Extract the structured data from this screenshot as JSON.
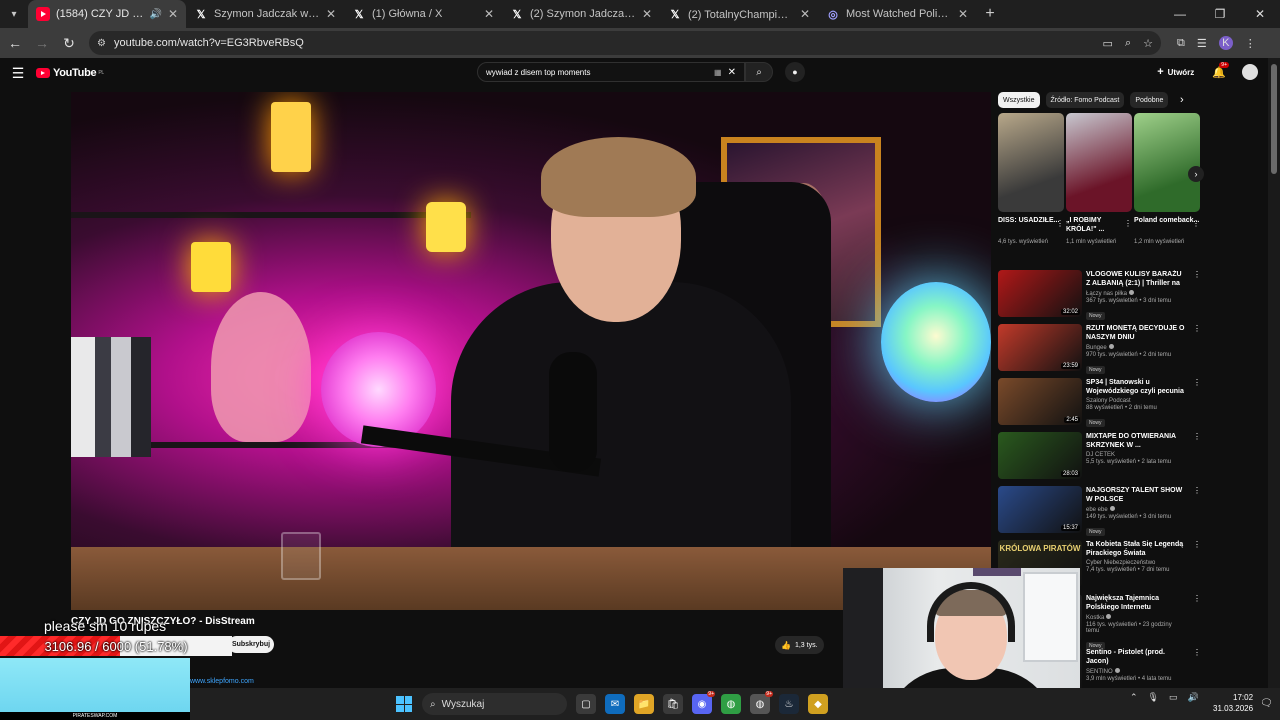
{
  "browser": {
    "tabs": [
      {
        "icon": "youtube-favicon",
        "title": "(1584) CZY JD GO ZNISZCZYŁO",
        "active": true,
        "audio": true
      },
      {
        "icon": "x-favicon",
        "title": "Szymon Jadczak w serwisie X: ..."
      },
      {
        "icon": "x-favicon",
        "title": "(1) Główna / X"
      },
      {
        "icon": "x-favicon",
        "title": "(2) Szymon Jadczak w serwisie X..."
      },
      {
        "icon": "x-favicon",
        "title": "(2) TotalnyChampion 🎅🧀 w serwisie X"
      },
      {
        "icon": "streams-favicon",
        "title": "Most Watched Polish Twitch Streams"
      }
    ],
    "url": "youtube.com/watch?v=EG3RbveRBsQ",
    "profile_initial": "K"
  },
  "youtube": {
    "logo_text": "YouTube",
    "logo_region": "PL",
    "search_query": "wywiad z disem top moments",
    "create_label": "Utwórz",
    "notifications_badge": "9+",
    "video": {
      "title": "CZY JD GO ZNISZCZYŁO? - DisStream",
      "subscribe_label": "Subskrybuj",
      "likes": "1,3 tys.",
      "description_link": "www.sklepfomo.com"
    },
    "chips": [
      "Wszystkie",
      "Źródło: Fomo Podcast",
      "Podobne"
    ],
    "shorts": [
      {
        "title": "DISS: USADZIŁE...",
        "views": "4,6 tys. wyświetleń",
        "colors": [
          "#3a3a3a",
          "#b8a88a"
        ]
      },
      {
        "title": "„I ROBIMY KRÓLA!\" ...",
        "views": "1,1 mln wyświetleń",
        "colors": [
          "#6b1428",
          "#c8c8d0"
        ]
      },
      {
        "title": "Poland comeback...",
        "views": "1,2 mln wyświetleń",
        "colors": [
          "#2f6b2a",
          "#9fd08a"
        ]
      }
    ],
    "recommendations": [
      {
        "title": "VLOGOWE KULISY BARAŻU Z ALBANIĄ (2:1) | Thriller na ...",
        "channel": "Łączy nas piłka",
        "verified": true,
        "meta": "367 tys. wyświetleń • 3 dni temu",
        "new": "Nowy",
        "duration": "32:02",
        "color": "#b01818"
      },
      {
        "title": "RZUT MONETĄ DECYDUJE O NASZYM DNIU",
        "channel": "Bungee",
        "verified": true,
        "meta": "970 tys. wyświetleń • 2 dni temu",
        "new": "Nowy",
        "duration": "23:59",
        "color": "#c23a2a"
      },
      {
        "title": "SP34 | Stanowski u Wojewódzkiego czyli pecunia ...",
        "channel": "Szalony Podcast",
        "verified": false,
        "meta": "88 wyświetleń • 2 dni temu",
        "new": "Nowy",
        "duration": "2:45",
        "color": "#7a4a2a"
      },
      {
        "title": "MIXTAPE DO OTWIERANIA SKRZYNEK W ...",
        "channel": "DJ CETEK",
        "verified": false,
        "meta": "5,5 tys. wyświetleń • 2 lata temu",
        "new": "",
        "duration": "28:03",
        "color": "#2a5a1e"
      },
      {
        "title": "NAJGORSZY TALENT SHOW W POLSCE",
        "channel": "ebe ebe",
        "verified": true,
        "meta": "149 tys. wyświetleń • 3 dni temu",
        "new": "Nowy",
        "duration": "15:37",
        "color": "#2a4a8a"
      },
      {
        "title": "Ta Kobieta Stała Się Legendą Pirackiego Świata",
        "channel": "Cyber Niebezpieczeństwo",
        "verified": false,
        "meta": "7,4 tys. wyświetleń • 7 dni temu",
        "new": "",
        "duration": "",
        "color": "#2a2a1a",
        "thumb_text": "KRÓLOWA PIRATÓW"
      },
      {
        "title": "Największa Tajemnica Polskiego Internetu",
        "channel": "Kostka",
        "verified": true,
        "meta": "116 tys. wyświetleń • 23 godziny temu",
        "new": "Nowy",
        "duration": "",
        "color": "#3a3a3a"
      },
      {
        "title": "Sentino - Pistolet (prod. Jacon)",
        "channel": "SENTINO",
        "verified": true,
        "meta": "3,9 mln wyświetleń • 4 lata temu",
        "new": "",
        "duration": "",
        "color": "#222222"
      }
    ]
  },
  "overlay": {
    "tts_text": "please sm 10 rupes",
    "goal_current": 3106.96,
    "goal_target": 6000,
    "goal_text": "3106.96 / 6000 (51.78%)",
    "goal_fraction": 0.5178,
    "sponsor_label": "PIRATESWAP.COM"
  },
  "taskbar": {
    "search_placeholder": "Wyszukaj",
    "apps": [
      {
        "icon": "task-view-icon",
        "badge": ""
      },
      {
        "icon": "outlook-icon",
        "badge": ""
      },
      {
        "icon": "file-explorer-icon",
        "badge": ""
      },
      {
        "icon": "store-icon",
        "badge": ""
      },
      {
        "icon": "discord-icon",
        "badge": "9+"
      },
      {
        "icon": "chrome-icon",
        "badge": ""
      },
      {
        "icon": "chrome-alt-icon",
        "badge": "9+"
      },
      {
        "icon": "steam-icon",
        "badge": ""
      },
      {
        "icon": "app-icon",
        "badge": ""
      }
    ],
    "time": "17:02",
    "date": "31.03.2026"
  },
  "colors": {
    "yt_bg": "#0f0f0f",
    "yt_red": "#ff0033",
    "goal_red": "#ff2a2a",
    "link_blue": "#3ea6ff"
  }
}
